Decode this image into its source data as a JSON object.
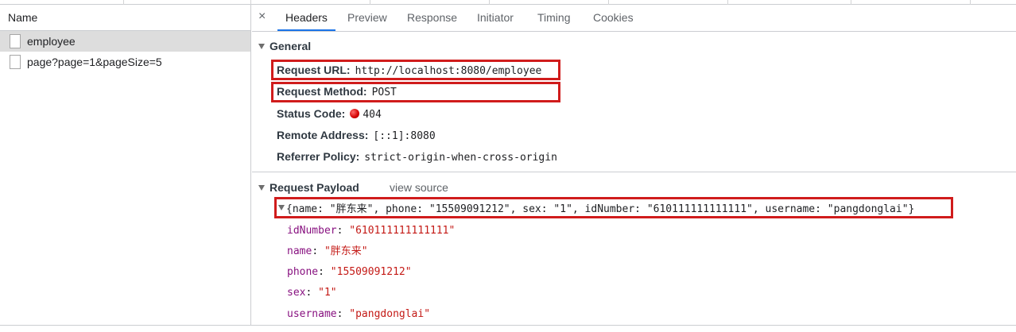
{
  "requests": {
    "header": "Name",
    "items": [
      {
        "label": "employee"
      },
      {
        "label": "page?page=1&pageSize=5"
      }
    ]
  },
  "tabs": {
    "close_glyph": "×",
    "items": [
      "Headers",
      "Preview",
      "Response",
      "Initiator",
      "Timing",
      "Cookies"
    ],
    "active": "Headers"
  },
  "general": {
    "title": "General",
    "rows": [
      {
        "key": "Request URL:",
        "value": "http://localhost:8080/employee"
      },
      {
        "key": "Request Method:",
        "value": "POST"
      },
      {
        "key": "Status Code:",
        "value": "404"
      },
      {
        "key": "Remote Address:",
        "value": "[::1]:8080"
      },
      {
        "key": "Referrer Policy:",
        "value": "strict-origin-when-cross-origin"
      }
    ]
  },
  "payload": {
    "title": "Request Payload",
    "view_source": "view source",
    "summary": "{name: \"胖东来\", phone: \"15509091212\", sex: \"1\", idNumber: \"610111111111111\", username: \"pangdonglai\"}",
    "props": [
      {
        "key": "idNumber",
        "value": "\"610111111111111\""
      },
      {
        "key": "name",
        "value": "\"胖东来\""
      },
      {
        "key": "phone",
        "value": "\"15509091212\""
      },
      {
        "key": "sex",
        "value": "\"1\""
      },
      {
        "key": "username",
        "value": "\"pangdonglai\""
      }
    ]
  },
  "colors": {
    "highlight_box": "#d01c1c",
    "active_tab_underline": "#1a73e8",
    "status_dot": "#d30000",
    "property_key": "#881280",
    "property_value": "#c41a16"
  }
}
